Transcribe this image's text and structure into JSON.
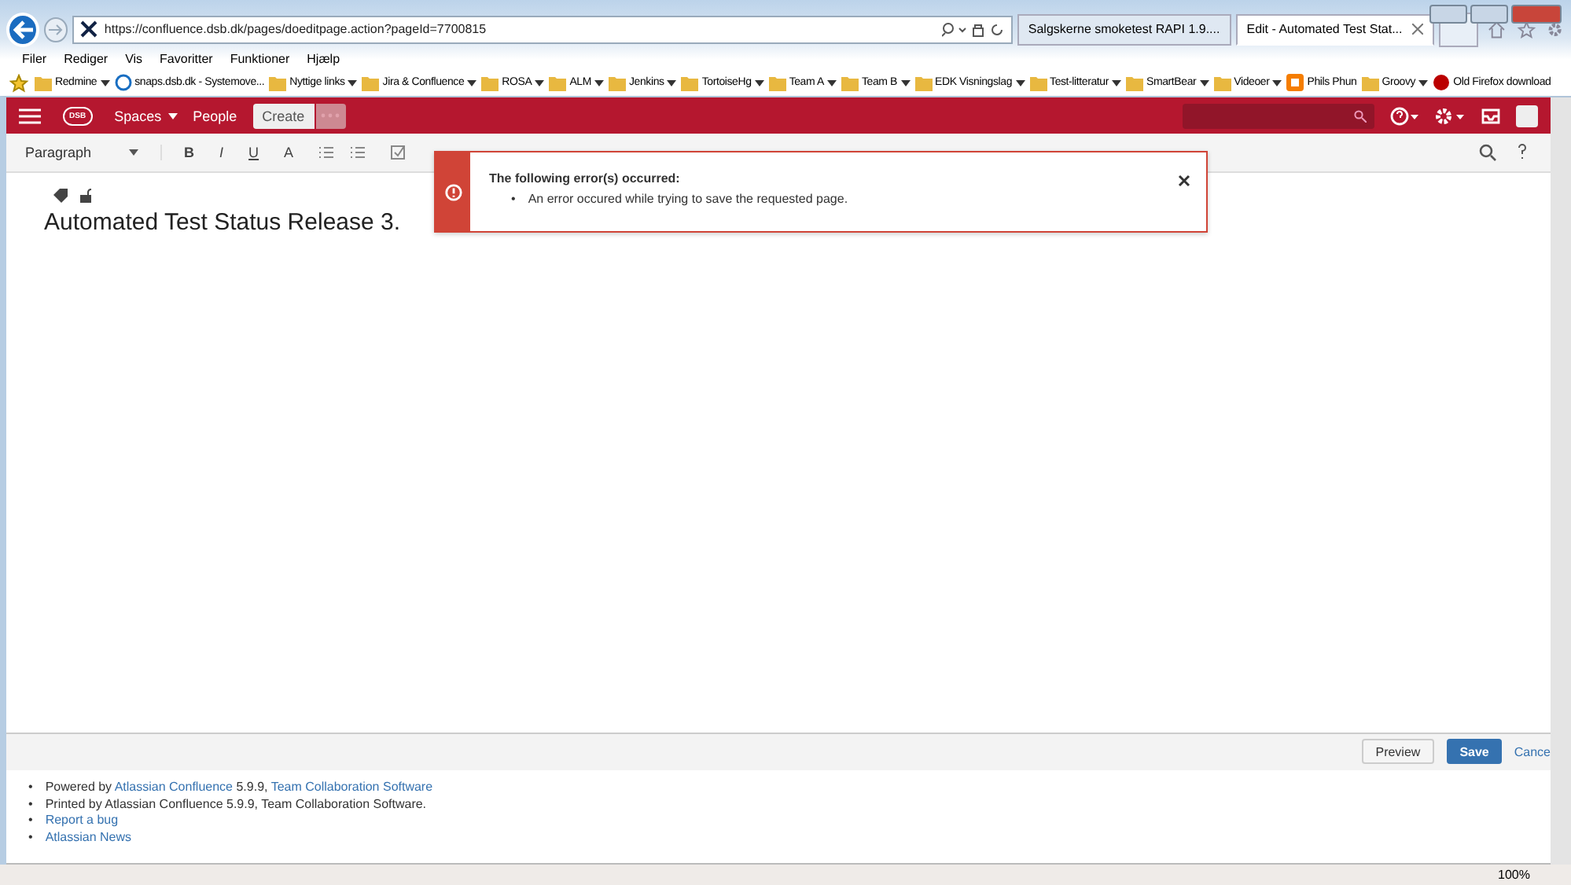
{
  "browser": {
    "address": "https://confluence.dsb.dk/pages/doeditpage.action?pageId=7700815",
    "tabs": [
      {
        "title": "Salgskerne smoketest RAPI 1.9....",
        "selected": false
      },
      {
        "title": "Edit - Automated Test Stat...",
        "selected": true
      }
    ],
    "menu": [
      "Filer",
      "Rediger",
      "Vis",
      "Favoritter",
      "Funktioner",
      "Hjælp"
    ],
    "favorites": [
      {
        "label": "Redmine",
        "kind": "folder",
        "dropdown": true
      },
      {
        "label": "snaps.dsb.dk - Systemove...",
        "kind": "page",
        "dropdown": false
      },
      {
        "label": "Nyttige links",
        "kind": "folder",
        "dropdown": true
      },
      {
        "label": "Jira & Confluence",
        "kind": "folder",
        "dropdown": true
      },
      {
        "label": "ROSA",
        "kind": "folder",
        "dropdown": true
      },
      {
        "label": "ALM",
        "kind": "folder",
        "dropdown": true
      },
      {
        "label": "Jenkins",
        "kind": "folder",
        "dropdown": true
      },
      {
        "label": "TortoiseHg",
        "kind": "folder",
        "dropdown": true
      },
      {
        "label": "Team A",
        "kind": "folder",
        "dropdown": true
      },
      {
        "label": "Team B",
        "kind": "folder",
        "dropdown": true
      },
      {
        "label": "EDK Visningslag",
        "kind": "folder",
        "dropdown": true
      },
      {
        "label": "Test-litteratur",
        "kind": "folder",
        "dropdown": true
      },
      {
        "label": "SmartBear",
        "kind": "folder",
        "dropdown": true
      },
      {
        "label": "Videoer",
        "kind": "folder",
        "dropdown": true
      },
      {
        "label": "Phils Phun",
        "kind": "blog",
        "dropdown": false
      },
      {
        "label": "Groovy",
        "kind": "folder",
        "dropdown": true
      },
      {
        "label": "Old Firefox download",
        "kind": "firefox",
        "dropdown": false
      }
    ],
    "zoom": "100%"
  },
  "header": {
    "logo": "DSB",
    "nav": [
      {
        "label": "Spaces",
        "dropdown": true
      },
      {
        "label": "People",
        "dropdown": false
      }
    ],
    "create": "Create"
  },
  "toolbar": {
    "format": "Paragraph",
    "text_buttons": [
      "B",
      "I",
      "U",
      "A"
    ]
  },
  "editor": {
    "title": "Automated Test Status Release 3."
  },
  "error": {
    "heading": "The following error(s) occurred:",
    "messages": [
      {
        "bullet": "•",
        "text": "An error occured while trying to save the requested page."
      }
    ]
  },
  "actions": {
    "preview": "Preview",
    "save": "Save",
    "cancel": "Cance"
  },
  "footer": [
    {
      "bullet": "•",
      "parts": [
        {
          "text": "Powered by ",
          "kind": "text"
        },
        {
          "text": "Atlassian Confluence",
          "kind": "link"
        },
        {
          "text": " 5.9.9, ",
          "kind": "text"
        },
        {
          "text": "Team Collaboration Software",
          "kind": "link"
        }
      ]
    },
    {
      "bullet": "•",
      "parts": [
        {
          "text": "Printed by Atlassian Confluence 5.9.9, Team Collaboration Software.",
          "kind": "text"
        }
      ]
    },
    {
      "bullet": "•",
      "parts": [
        {
          "text": "Report a bug",
          "kind": "link"
        }
      ]
    },
    {
      "bullet": "•",
      "parts": [
        {
          "text": "Atlassian News",
          "kind": "link"
        }
      ]
    }
  ]
}
